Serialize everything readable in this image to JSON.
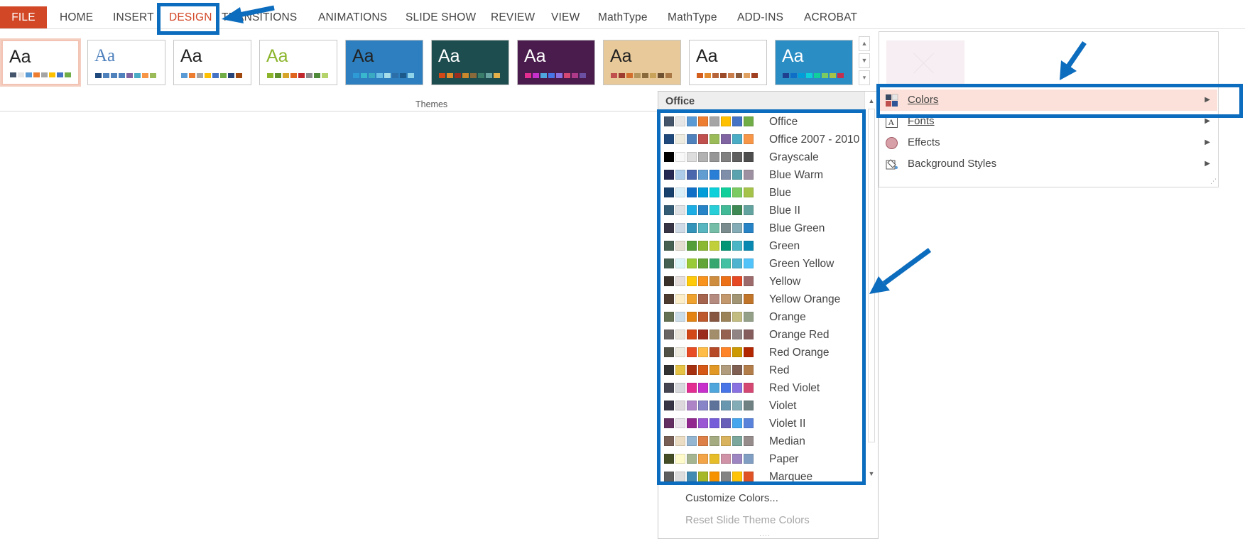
{
  "ribbon": {
    "tabs": [
      {
        "label": "FILE"
      },
      {
        "label": "HOME"
      },
      {
        "label": "INSERT"
      },
      {
        "label": "DESIGN"
      },
      {
        "label": "TRANSITIONS"
      },
      {
        "label": "ANIMATIONS"
      },
      {
        "label": "SLIDE SHOW"
      },
      {
        "label": "REVIEW"
      },
      {
        "label": "VIEW"
      },
      {
        "label": "MathType"
      },
      {
        "label": "MathType"
      },
      {
        "label": "ADD-INS"
      },
      {
        "label": "ACROBAT"
      }
    ],
    "active_tab": "DESIGN",
    "file_tab_color": "#d24726"
  },
  "themes": {
    "group_label": "Themes",
    "thumbnails": [
      {
        "text": "Aa",
        "bg": "#ffffff",
        "ink": "#222222",
        "swatches": [
          "#44546a",
          "#e7e6e6",
          "#5b9bd5",
          "#ed7d31",
          "#a5a5a5",
          "#ffc000",
          "#4472c4",
          "#70ad47"
        ],
        "selected": true
      },
      {
        "text": "Aa",
        "bg": "#ffffff",
        "ink": "#4f81bd",
        "swatches": [
          "#1f497d",
          "#4f81bd",
          "#4f81bd",
          "#4f81bd",
          "#8064a2",
          "#4bacc6",
          "#f79646",
          "#9bbb59"
        ]
      },
      {
        "text": "Aa",
        "bg": "#ffffff",
        "ink": "#222222",
        "swatches": [
          "#5b9bd5",
          "#ed7d31",
          "#a5a5a5",
          "#ffc000",
          "#4472c4",
          "#70ad47",
          "#264478",
          "#9e480e"
        ]
      },
      {
        "text": "Aa",
        "bg": "#ffffff",
        "ink": "#8cb52c",
        "swatches": [
          "#8cb52c",
          "#60912a",
          "#d6a52a",
          "#e0661f",
          "#c0282d",
          "#8a8a8a",
          "#4f8a3a",
          "#b4d36b"
        ]
      },
      {
        "text": "Aa",
        "bg": "#2d7fbf",
        "ink": "#222222",
        "swatches": [
          "#2e9bd6",
          "#39b7cf",
          "#3aaac3",
          "#6cc0e5",
          "#a6dde8",
          "#2b6ea8",
          "#1b5a8a",
          "#8fd4e8"
        ]
      },
      {
        "text": "Aa",
        "bg": "#1e4d4f",
        "ink": "#ffffff",
        "swatches": [
          "#d34817",
          "#e08a2a",
          "#9b2d1f",
          "#c9882c",
          "#8a6a3a",
          "#3a7d6b",
          "#6aa4a0",
          "#e4b04a"
        ]
      },
      {
        "text": "Aa",
        "bg": "#4a1b4d",
        "ink": "#ffffff",
        "swatches": [
          "#e32d91",
          "#c830cc",
          "#4ea6dc",
          "#4775e7",
          "#8971e1",
          "#d54773",
          "#b03a8a",
          "#6b4fa0"
        ]
      },
      {
        "text": "Aa",
        "bg": "#e8c99a",
        "ink": "#222222",
        "swatches": [
          "#c0504d",
          "#9e3d2f",
          "#d36f2d",
          "#b3945a",
          "#8a6a3a",
          "#c9a35a",
          "#6f5232",
          "#a97845"
        ]
      },
      {
        "text": "Aa",
        "bg": "#ffffff",
        "ink": "#222222",
        "swatches": [
          "#d35e1e",
          "#e28b2f",
          "#b8643b",
          "#9b4a2a",
          "#c97d4a",
          "#8a5a3a",
          "#e0a060",
          "#a04020"
        ]
      },
      {
        "text": "Aa",
        "bg": "#2a8ec5",
        "ink": "#ffffff",
        "swatches": [
          "#1f3f8f",
          "#0f6fc6",
          "#009dd9",
          "#0bd0d9",
          "#10cf9b",
          "#7cca62",
          "#a5c249",
          "#c3304f"
        ]
      }
    ]
  },
  "variants_panel": {
    "menu": [
      {
        "label": "Colors",
        "icon": "colors-icon"
      },
      {
        "label": "Fonts",
        "icon": "fonts-icon"
      },
      {
        "label": "Effects",
        "icon": "effects-icon"
      },
      {
        "label": "Background Styles",
        "icon": "background-styles-icon"
      }
    ]
  },
  "colors_menu": {
    "header": "Office",
    "schemes": [
      {
        "name": "Office",
        "colors": [
          "#44546a",
          "#e7e6e6",
          "#5b9bd5",
          "#ed7d31",
          "#a5a5a5",
          "#ffc000",
          "#4472c4",
          "#70ad47"
        ]
      },
      {
        "name": "Office 2007 - 2010",
        "colors": [
          "#1f497d",
          "#eeece1",
          "#4f81bd",
          "#c0504d",
          "#9bbb59",
          "#8064a2",
          "#4bacc6",
          "#f79646"
        ]
      },
      {
        "name": "Grayscale",
        "colors": [
          "#000000",
          "#f8f8f8",
          "#dddddd",
          "#b2b2b2",
          "#969696",
          "#808080",
          "#5f5f5f",
          "#4d4d4d"
        ]
      },
      {
        "name": "Blue Warm",
        "colors": [
          "#242852",
          "#acccea",
          "#4a66ac",
          "#629dd1",
          "#297fd5",
          "#7f8fa9",
          "#5aa2ae",
          "#9d90a0"
        ]
      },
      {
        "name": "Blue",
        "colors": [
          "#17406d",
          "#dbeff9",
          "#0f6fc6",
          "#009dd9",
          "#0bd0d9",
          "#10cf9b",
          "#7cca62",
          "#a5c249"
        ]
      },
      {
        "name": "Blue II",
        "colors": [
          "#335b74",
          "#dfe3e5",
          "#1cade4",
          "#2683c6",
          "#27ced7",
          "#42ba97",
          "#3e8853",
          "#62a39f"
        ]
      },
      {
        "name": "Blue Green",
        "colors": [
          "#373545",
          "#cedbe6",
          "#3494ba",
          "#58b6c0",
          "#75bda7",
          "#7a8c8e",
          "#84acb6",
          "#2683c6"
        ]
      },
      {
        "name": "Green",
        "colors": [
          "#455f51",
          "#e3ded1",
          "#549e39",
          "#8ab833",
          "#c0cf3a",
          "#029676",
          "#4ab5c4",
          "#0989b1"
        ]
      },
      {
        "name": "Green Yellow",
        "colors": [
          "#455f51",
          "#dbf5f9",
          "#99cb38",
          "#63a537",
          "#37a76f",
          "#44c1a3",
          "#4eb3cf",
          "#51c3f9"
        ]
      },
      {
        "name": "Yellow",
        "colors": [
          "#39302a",
          "#e5dedb",
          "#ffca08",
          "#f8931d",
          "#ce8d3e",
          "#ec7016",
          "#e64823",
          "#9c6a6a"
        ]
      },
      {
        "name": "Yellow Orange",
        "colors": [
          "#4e3b30",
          "#fbeec9",
          "#f0a22e",
          "#a5644e",
          "#b58b80",
          "#c3986d",
          "#a19574",
          "#c17529"
        ]
      },
      {
        "name": "Orange",
        "colors": [
          "#637052",
          "#ccddea",
          "#e48312",
          "#bd582c",
          "#865640",
          "#9b8357",
          "#c2bc80",
          "#94a088"
        ]
      },
      {
        "name": "Orange Red",
        "colors": [
          "#696464",
          "#e9e5dc",
          "#d34817",
          "#9b2d1f",
          "#a28e6a",
          "#956251",
          "#918485",
          "#855d5d"
        ]
      },
      {
        "name": "Red Orange",
        "colors": [
          "#505046",
          "#eeece1",
          "#e84c22",
          "#ffbd47",
          "#b64926",
          "#ff8427",
          "#cc9900",
          "#b22600"
        ]
      },
      {
        "name": "Red",
        "colors": [
          "#323232",
          "#e5c243",
          "#a5300f",
          "#d55816",
          "#e19825",
          "#b19c7d",
          "#7f5f52",
          "#b27d49"
        ]
      },
      {
        "name": "Red Violet",
        "colors": [
          "#454551",
          "#d8d9dc",
          "#e32d91",
          "#c830cc",
          "#4ea6dc",
          "#4775e7",
          "#8971e1",
          "#d54773"
        ]
      },
      {
        "name": "Violet",
        "colors": [
          "#373545",
          "#dcd8dc",
          "#ad84c6",
          "#8784c7",
          "#5d739a",
          "#6997af",
          "#84acb6",
          "#6f8183"
        ]
      },
      {
        "name": "Violet II",
        "colors": [
          "#632e62",
          "#eae5eb",
          "#92278f",
          "#9b57d3",
          "#755dd9",
          "#665eb8",
          "#45a5ed",
          "#5982db"
        ]
      },
      {
        "name": "Median",
        "colors": [
          "#775f55",
          "#ebddc3",
          "#94b6d2",
          "#dd8047",
          "#a5ab81",
          "#d8b25c",
          "#7ba79d",
          "#968c8c"
        ]
      },
      {
        "name": "Paper",
        "colors": [
          "#444d26",
          "#fefac9",
          "#a5b592",
          "#f3a447",
          "#e7bc29",
          "#d092a7",
          "#9c85c0",
          "#809ec2"
        ]
      },
      {
        "name": "Marquee",
        "colors": [
          "#5e5e5e",
          "#dddddd",
          "#418ab3",
          "#a6b727",
          "#f69200",
          "#838383",
          "#fec306",
          "#df5327"
        ]
      }
    ],
    "footer": {
      "customize": "Customize Colors...",
      "reset": "Reset Slide Theme Colors"
    }
  },
  "annotation_color": "#0c6cbd"
}
